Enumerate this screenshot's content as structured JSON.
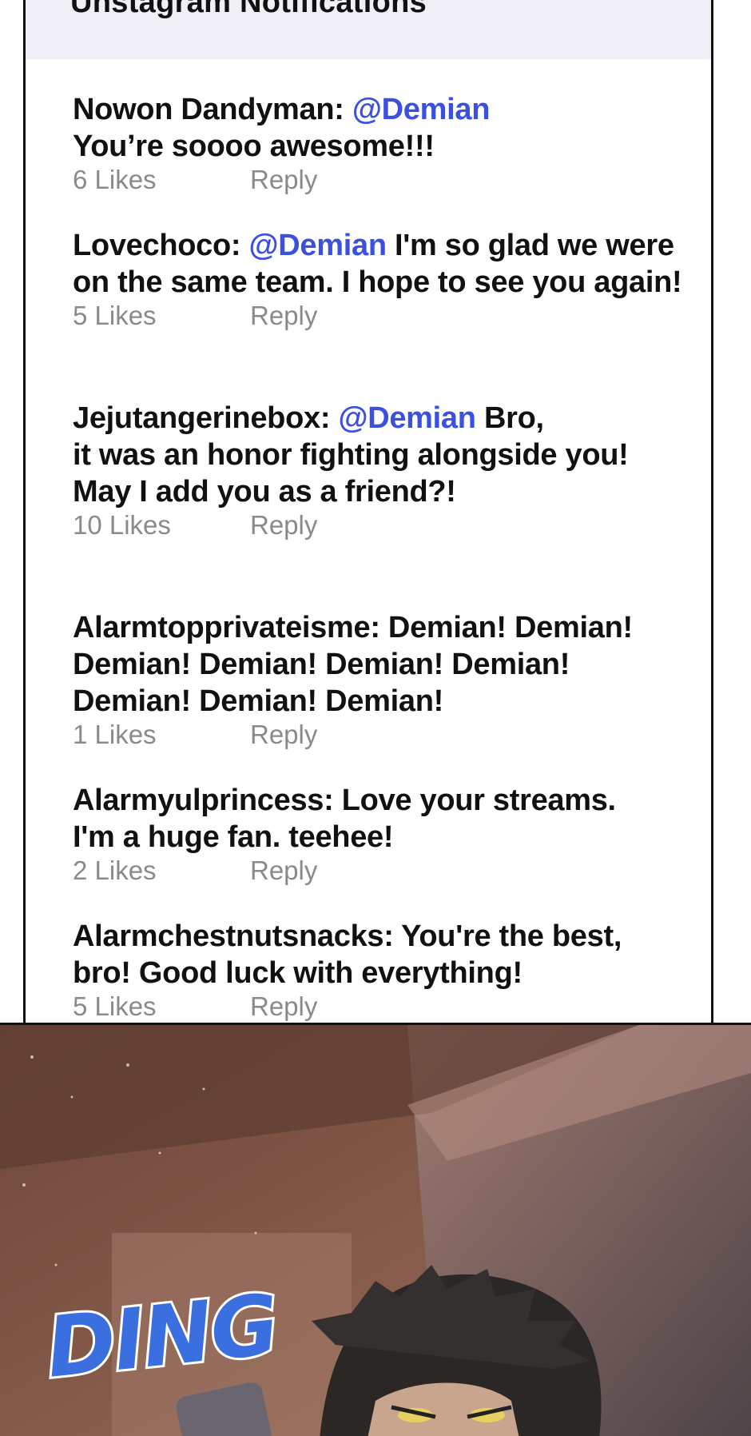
{
  "header": {
    "title": "Unstagram Notifications"
  },
  "comments": [
    {
      "user": "Nowon Dandyman:",
      "mention": "@Demian",
      "text_line1": "",
      "text_rest": "You’re soooo awesome!!!",
      "likes": "6 Likes",
      "reply": "Reply"
    },
    {
      "user": "Lovechoco:",
      "mention": "@Demian",
      "text_line1": " I'm so glad we were",
      "text_rest": "on the same team. I hope to see you again!",
      "likes": "5 Likes",
      "reply": "Reply"
    },
    {
      "user": "Jejutangerinebox:",
      "mention": "@Demian",
      "text_line1": " Bro,",
      "text_rest": "it was an honor fighting alongside you!\nMay I add you as a friend?!",
      "likes": "10 Likes",
      "reply": "Reply"
    },
    {
      "user": "Alarmtopprivateisme:",
      "mention": "",
      "text_line1": " Demian! Demian!",
      "text_rest": "Demian! Demian! Demian! Demian!\nDemian! Demian! Demian!",
      "likes": "1 Likes",
      "reply": "Reply"
    },
    {
      "user": "Alarmyulprincess:",
      "mention": "",
      "text_line1": " Love your streams.",
      "text_rest": "I'm a huge fan. teehee!",
      "likes": "2 Likes",
      "reply": "Reply"
    },
    {
      "user": "Alarmchestnutsnacks:",
      "mention": "",
      "text_line1": " You're the best,",
      "text_rest": "bro! Good luck with everything!",
      "likes": "5 Likes",
      "reply": "Reply"
    }
  ],
  "scene": {
    "sound_effect": "DING"
  },
  "colors": {
    "mention": "#3b4fe0",
    "meta": "#8a8a8a",
    "header_bg": "#efeff5"
  }
}
